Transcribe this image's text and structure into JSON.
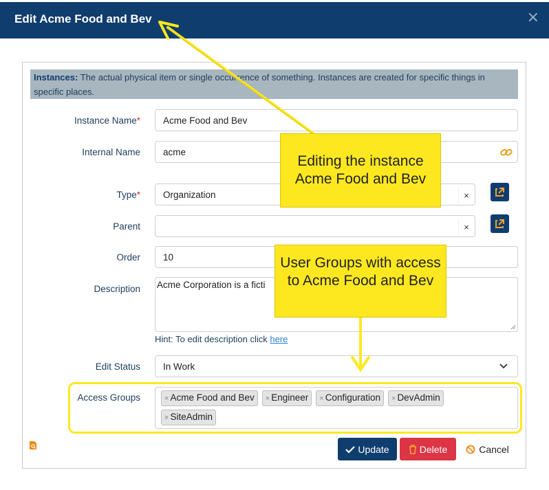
{
  "dialog": {
    "title": "Edit Acme Food and Bev",
    "close_label": "×"
  },
  "info": {
    "heading": "Instances:",
    "text": " The actual physical item or single occurrence of something. Instances are created for specific things in specific places."
  },
  "fields": {
    "instance_name": {
      "label": "Instance Name",
      "required": "*",
      "value": "Acme Food and Bev"
    },
    "internal_name": {
      "label": "Internal Name",
      "value": "acme"
    },
    "type": {
      "label": "Type",
      "required": "*",
      "value": "Organization",
      "clear": "×"
    },
    "parent": {
      "label": "Parent",
      "value": "",
      "clear": "×"
    },
    "order": {
      "label": "Order",
      "value": "10"
    },
    "description": {
      "label": "Description",
      "value": "Acme Corporation is a ficti"
    },
    "hint": {
      "text": "Hint: To edit description click ",
      "link": "here"
    },
    "edit_status": {
      "label": "Edit Status",
      "value": "In Work"
    },
    "access_groups": {
      "label": "Access Groups",
      "tags": [
        {
          "remove": "×",
          "name": "Acme Food and Bev"
        },
        {
          "remove": "×",
          "name": "Engineer"
        },
        {
          "remove": "×",
          "name": "Configuration"
        },
        {
          "remove": "×",
          "name": "DevAdmin"
        },
        {
          "remove": "×",
          "name": "SiteAdmin"
        }
      ]
    }
  },
  "buttons": {
    "update": "Update",
    "delete": "Delete",
    "cancel": "Cancel"
  },
  "callouts": {
    "editing": "Editing the instance Acme Food and Bev",
    "groups": "User Groups with access to Acme Food and Bev"
  },
  "colors": {
    "header": "#0f3d6e",
    "callout": "#fde820",
    "delete": "#dc3545",
    "link_icon": "#e8a020"
  },
  "icons": [
    "close-icon",
    "link-icon",
    "external-link-icon",
    "chevron-down-icon",
    "check-icon",
    "trash-icon",
    "ban-icon",
    "search-doc-icon"
  ]
}
